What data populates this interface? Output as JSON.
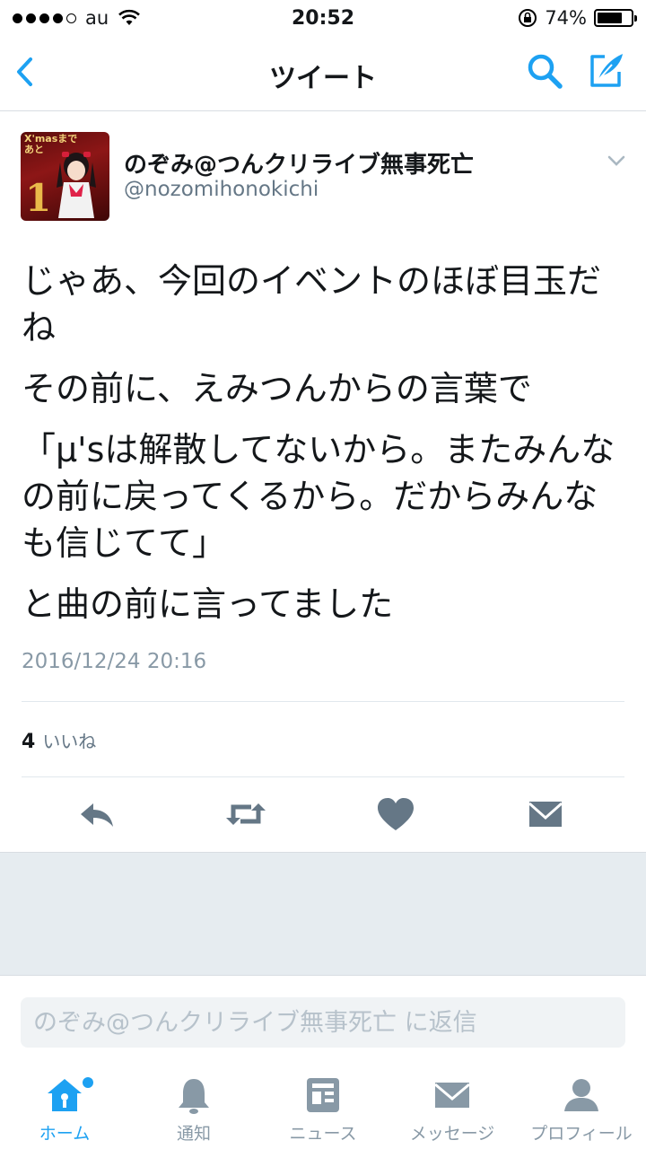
{
  "status_bar": {
    "carrier": "au",
    "time": "20:52",
    "battery_percent": "74%",
    "battery_level": 0.74
  },
  "nav": {
    "title": "ツイート",
    "icons": [
      "back-chevron-icon",
      "search-icon",
      "compose-icon"
    ]
  },
  "tweet": {
    "avatar": {
      "badge": "X'masまで\nあと",
      "number": "1"
    },
    "display_name": "のぞみ@つんクリライブ無事死亡",
    "screen_name": "@nozomihonokichi",
    "paragraphs": [
      "じゃあ、今回のイベントのほぼ目玉だね",
      "その前に、えみつんからの言葉で",
      "「μ'sは解散してないから。またみんなの前に戻ってくるから。だからみんなも信じてて」",
      "と曲の前に言ってました"
    ],
    "timestamp": "2016/12/24 20:16",
    "likes_count": "4",
    "likes_label": "いいね"
  },
  "actions": [
    "reply-icon",
    "retweet-icon",
    "like-icon",
    "message-icon"
  ],
  "reply": {
    "placeholder": "のぞみ@つんクリライブ無事死亡 に返信"
  },
  "tabs": [
    {
      "label": "ホーム",
      "icon": "home-icon",
      "active": true
    },
    {
      "label": "通知",
      "icon": "bell-icon",
      "active": false
    },
    {
      "label": "ニュース",
      "icon": "news-icon",
      "active": false
    },
    {
      "label": "メッセージ",
      "icon": "envelope-icon",
      "active": false
    },
    {
      "label": "プロフィール",
      "icon": "person-icon",
      "active": false
    }
  ],
  "colors": {
    "accent": "#1da1f2",
    "text": "#14171a",
    "secondary": "#657786",
    "icon_gray": "#8899a6",
    "background_gray": "#e6ecf0"
  }
}
